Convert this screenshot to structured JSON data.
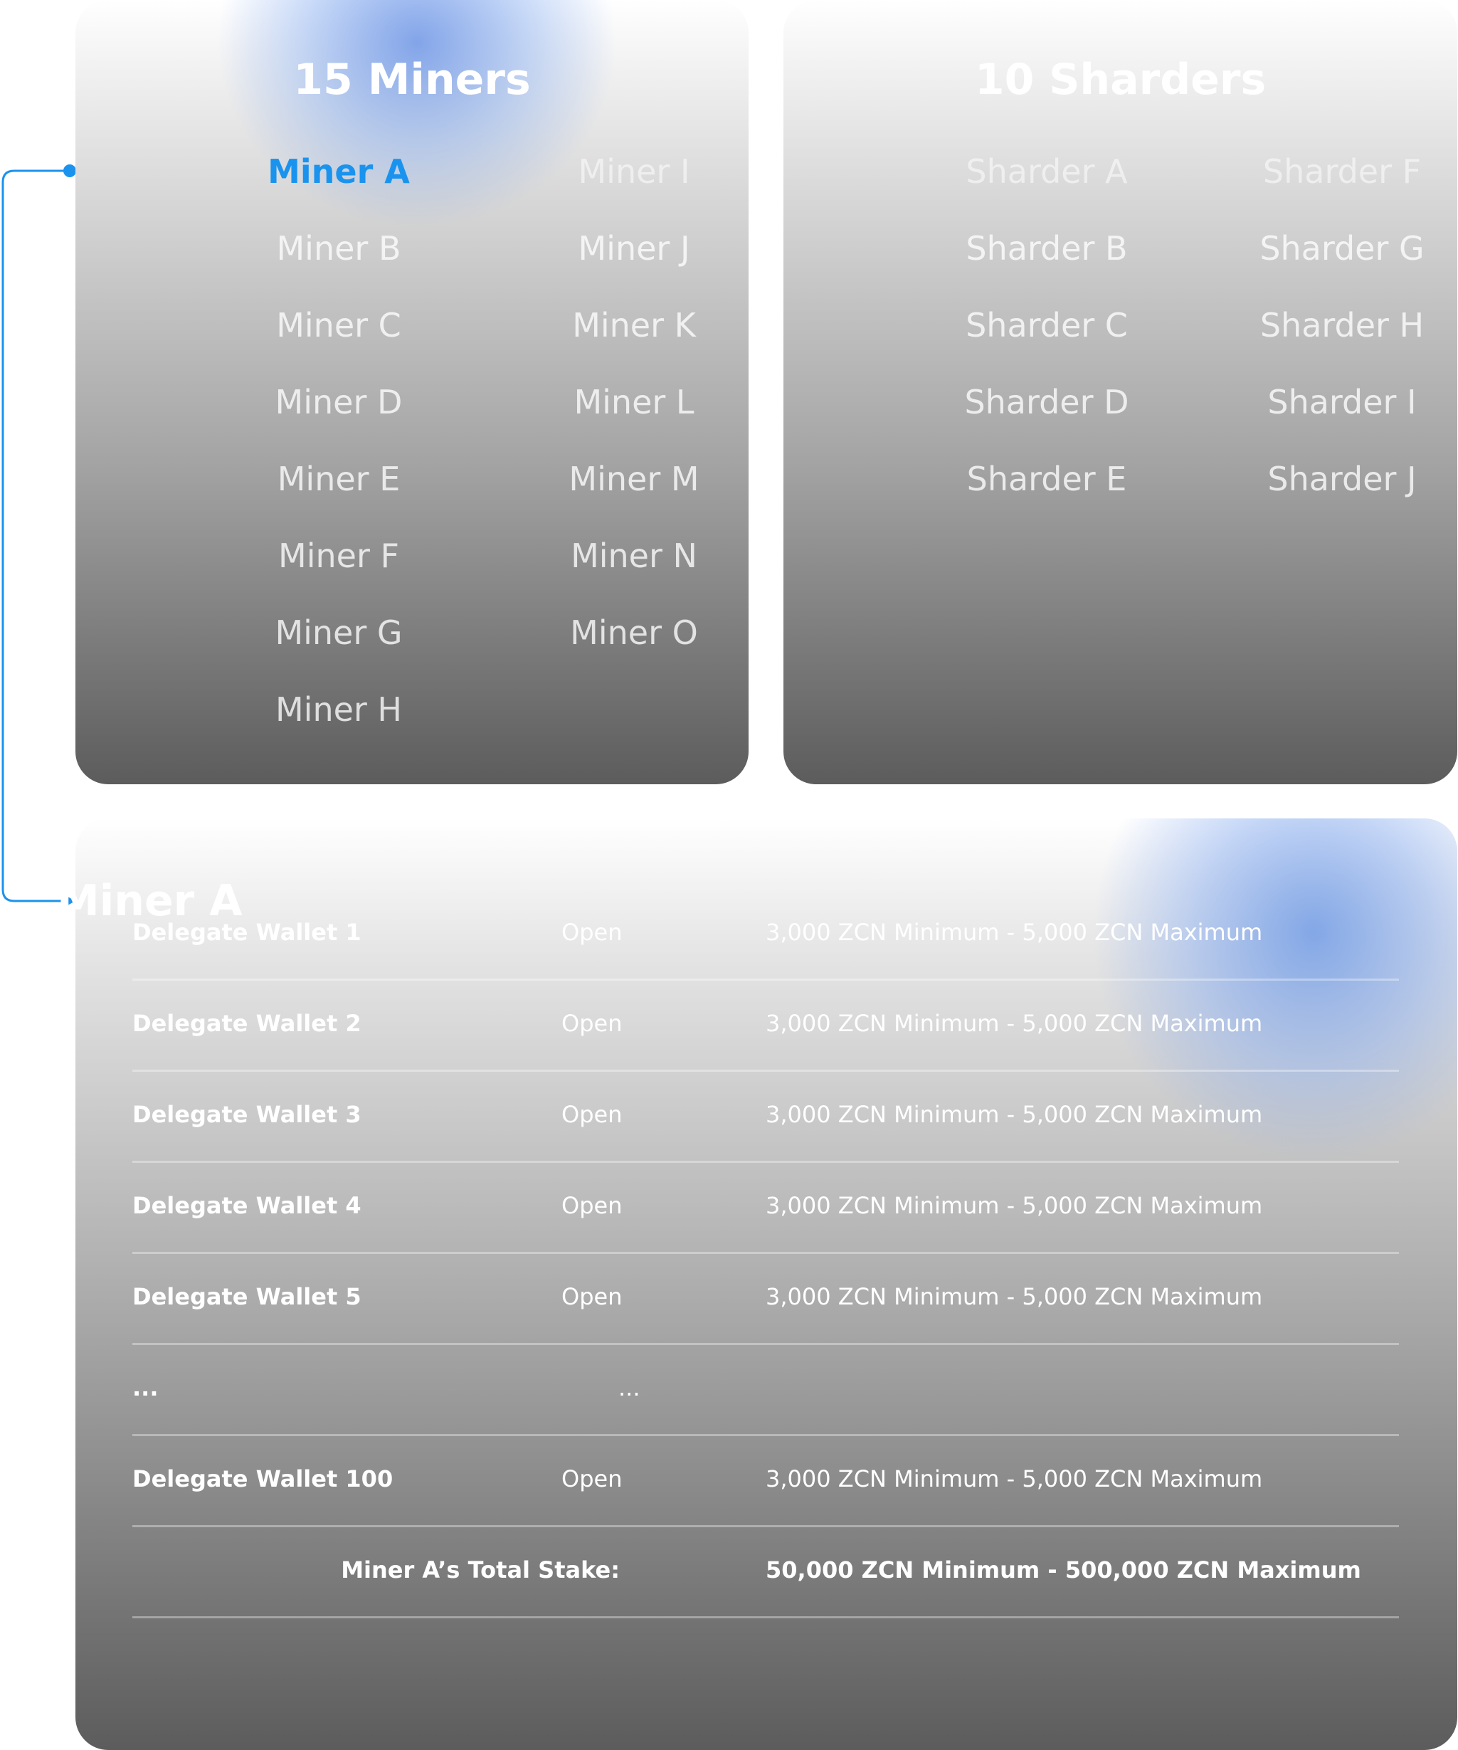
{
  "colors": {
    "accent": "#1a93ee",
    "text": "#ffffff"
  },
  "miners": {
    "title": "15 Miners",
    "items": [
      "Miner A",
      "Miner B",
      "Miner C",
      "Miner D",
      "Miner E",
      "Miner F",
      "Miner G",
      "Miner H",
      "Miner I",
      "Miner J",
      "Miner K",
      "Miner L",
      "Miner M",
      "Miner N",
      "Miner O"
    ],
    "selected": "Miner A"
  },
  "sharders": {
    "title": "10 Sharders",
    "items": [
      "Sharder A",
      "Sharder B",
      "Sharder C",
      "Sharder D",
      "Sharder E",
      "Sharder F",
      "Sharder G",
      "Sharder H",
      "Sharder I",
      "Sharder J"
    ]
  },
  "detail": {
    "title": "Miner A",
    "rows": [
      {
        "name": "Delegate Wallet 1",
        "status": "Open",
        "range": "3,000 ZCN Minimum - 5,000 ZCN Maximum"
      },
      {
        "name": "Delegate Wallet 2",
        "status": "Open",
        "range": "3,000 ZCN Minimum - 5,000 ZCN Maximum"
      },
      {
        "name": "Delegate Wallet 3",
        "status": "Open",
        "range": "3,000 ZCN Minimum - 5,000 ZCN Maximum"
      },
      {
        "name": "Delegate Wallet 4",
        "status": "Open",
        "range": "3,000 ZCN Minimum - 5,000 ZCN Maximum"
      },
      {
        "name": "Delegate Wallet 5",
        "status": "Open",
        "range": "3,000 ZCN Minimum - 5,000 ZCN Maximum"
      },
      {
        "name": "...",
        "status": "...",
        "range": ""
      },
      {
        "name": "Delegate Wallet 100",
        "status": "Open",
        "range": "3,000 ZCN Minimum - 5,000 ZCN Maximum"
      }
    ],
    "total_label": "Miner A’s Total Stake:",
    "total_value": "50,000 ZCN Minimum - 500,000 ZCN Maximum"
  }
}
